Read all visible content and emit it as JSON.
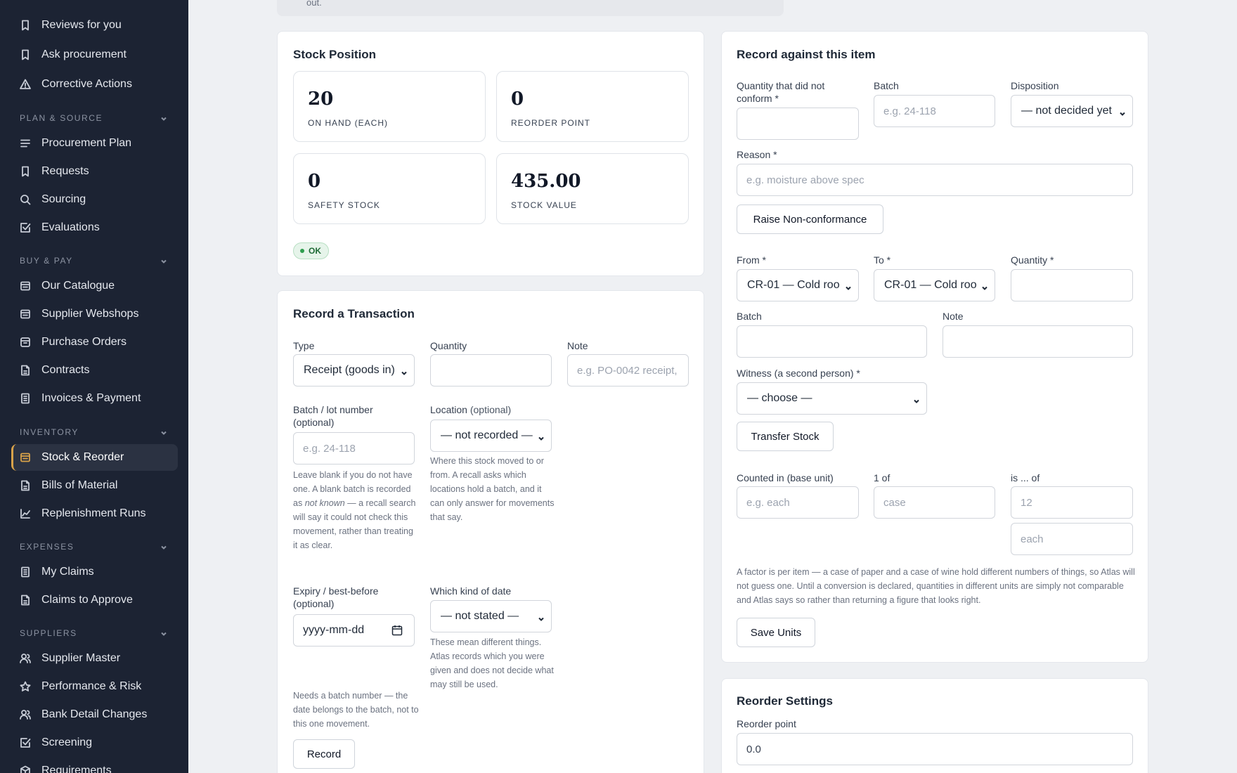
{
  "sidebar": {
    "items_top": [
      {
        "label": "Reviews for you",
        "icon": "bookmark-icon"
      },
      {
        "label": "Ask procurement",
        "icon": "bookmark-icon"
      },
      {
        "label": "Corrective Actions",
        "icon": "warning-triangle-icon"
      }
    ],
    "sections": [
      {
        "title": "PLAN & SOURCE",
        "items": [
          {
            "label": "Procurement Plan",
            "icon": "list-icon"
          },
          {
            "label": "Requests",
            "icon": "bookmark-icon"
          },
          {
            "label": "Sourcing",
            "icon": "search-icon"
          },
          {
            "label": "Evaluations",
            "icon": "checkbox-icon"
          }
        ]
      },
      {
        "title": "BUY & PAY",
        "items": [
          {
            "label": "Our Catalogue",
            "icon": "catalogue-icon"
          },
          {
            "label": "Supplier Webshops",
            "icon": "catalogue-icon"
          },
          {
            "label": "Purchase Orders",
            "icon": "box-icon"
          },
          {
            "label": "Contracts",
            "icon": "document-icon"
          },
          {
            "label": "Invoices & Payment",
            "icon": "receipt-icon"
          }
        ]
      },
      {
        "title": "INVENTORY",
        "items": [
          {
            "label": "Stock & Reorder",
            "icon": "catalogue-icon",
            "active": true
          },
          {
            "label": "Bills of Material",
            "icon": "document-icon"
          },
          {
            "label": "Replenishment Runs",
            "icon": "line-chart-icon"
          }
        ]
      },
      {
        "title": "EXPENSES",
        "items": [
          {
            "label": "My Claims",
            "icon": "receipt-icon"
          },
          {
            "label": "Claims to Approve",
            "icon": "document-icon"
          }
        ]
      },
      {
        "title": "SUPPLIERS",
        "items": [
          {
            "label": "Supplier Master",
            "icon": "users-icon"
          },
          {
            "label": "Performance & Risk",
            "icon": "star-icon"
          },
          {
            "label": "Bank Detail Changes",
            "icon": "users-icon"
          },
          {
            "label": "Screening",
            "icon": "checkbox-icon"
          },
          {
            "label": "Requirements",
            "icon": "cube-icon"
          }
        ]
      }
    ],
    "accent_color": "#d8a24a"
  },
  "notice": {
    "text": "out."
  },
  "stock_position": {
    "title": "Stock Position",
    "stats": [
      {
        "value": "20",
        "label": "ON HAND (EACH)"
      },
      {
        "value": "0",
        "label": "REORDER POINT"
      },
      {
        "value": "0",
        "label": "SAFETY STOCK"
      },
      {
        "value": "435.00",
        "label": "STOCK VALUE"
      }
    ],
    "status": "OK"
  },
  "transaction": {
    "title": "Record a Transaction",
    "type_label": "Type",
    "type_value": "Receipt (goods in)",
    "quantity_label": "Quantity",
    "note_label": "Note",
    "note_placeholder": "e.g. PO-0042 receipt,",
    "batch_label": "Batch / lot number",
    "batch_label_2": "(optional)",
    "batch_placeholder": "e.g. 24-118",
    "batch_help_1": "Leave blank if you do not have one. A blank batch is recorded as ",
    "batch_help_em": "not known",
    "batch_help_2": " — a recall search will say it could not check this movement, rather than treating it as clear.",
    "location_label": "Location",
    "location_optional": "(optional)",
    "location_value": "— not recorded —",
    "location_help": "Where this stock moved to or from. A recall asks which locations hold a batch, and it can only answer for movements that say.",
    "expiry_label": "Expiry / best-before",
    "expiry_label_2": "(optional)",
    "expiry_placeholder": "yyyy-mm-dd",
    "date_kind_label": "Which kind of date",
    "date_kind_value": "— not stated —",
    "date_kind_help": "These mean different things. Atlas records which you were given and does not decide what may still be used.",
    "expiry_help": "Needs a batch number — the date belongs to the batch, not to this one movement.",
    "record_button": "Record"
  },
  "record_item": {
    "title": "Record against this item",
    "nc_qty_label": "Quantity that did not conform *",
    "nc_batch_label": "Batch",
    "nc_batch_placeholder": "e.g. 24-118",
    "disposition_label": "Disposition",
    "disposition_value": "— not decided yet",
    "reason_label": "Reason *",
    "reason_placeholder": "e.g. moisture above spec",
    "raise_button": "Raise Non-conformance",
    "from_label": "From *",
    "from_value": "CR-01 — Cold roo",
    "to_label": "To *",
    "to_value": "CR-01 — Cold roo",
    "transfer_qty_label": "Quantity *",
    "transfer_batch_label": "Batch",
    "transfer_note_label": "Note",
    "witness_label": "Witness (a second person) *",
    "witness_value": "— choose —",
    "transfer_button": "Transfer Stock",
    "counted_label": "Counted in (base unit)",
    "counted_placeholder": "e.g. each",
    "one_of_label": "1 of",
    "one_of_placeholder": "case",
    "is_of_label": "is ... of",
    "is_of_placeholder": "12",
    "is_of_unit_placeholder": "each",
    "units_help": "A factor is per item — a case of paper and a case of wine hold different numbers of things, so Atlas will not guess one. Until a conversion is declared, quantities in different units are simply not comparable and Atlas says so rather than returning a figure that looks right.",
    "save_units_button": "Save Units"
  },
  "reorder": {
    "title": "Reorder Settings",
    "reorder_point_label": "Reorder point",
    "reorder_point_value": "0.0"
  }
}
